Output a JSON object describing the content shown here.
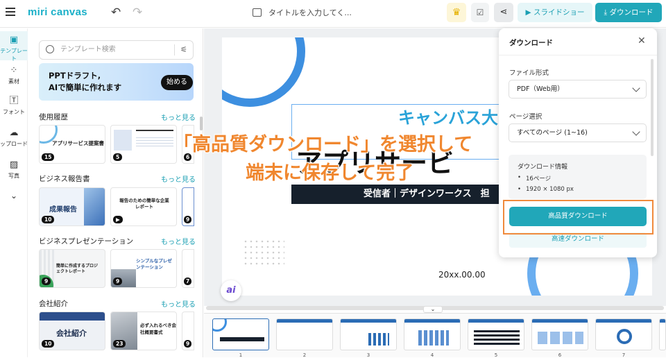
{
  "app": {
    "logo": "miri canvas"
  },
  "header": {
    "doc_title": "タイトルを入力してく...",
    "slideshow_label": "スライドショー",
    "download_label": "ダウンロード"
  },
  "rail": [
    {
      "label": "テンプレート",
      "icon": "template-icon"
    },
    {
      "label": "素材",
      "icon": "elements-icon"
    },
    {
      "label": "フォント",
      "icon": "text-icon"
    },
    {
      "label": "ップロード",
      "icon": "upload-icon"
    },
    {
      "label": "写真",
      "icon": "photo-icon"
    }
  ],
  "panel": {
    "search_placeholder": "テンプレート検索",
    "promo_line1": "PPTドラフト,",
    "promo_line2": "AIで簡単に作れます",
    "promo_button": "始める",
    "more_label": "もっと見る",
    "sections": [
      {
        "title": "使用履歴",
        "thumbs": [
          {
            "num": "15",
            "caption": "アプリサービス提案書"
          },
          {
            "num": "5",
            "caption": ""
          }
        ],
        "extra_num": "6"
      },
      {
        "title": "ビジネス報告書",
        "thumbs": [
          {
            "num": "10",
            "caption": "成果報告"
          },
          {
            "num": "",
            "caption": "報告のための簡単な企業レポート"
          }
        ],
        "extra_num": "9"
      },
      {
        "title": "ビジネスプレゼンテーション",
        "thumbs": [
          {
            "num": "9",
            "caption": "簡単に作成するプロジェクトレポート"
          },
          {
            "num": "9",
            "caption": "シンプルなプレゼンテーション"
          }
        ],
        "extra_num": "7"
      },
      {
        "title": "会社紹介",
        "thumbs": [
          {
            "num": "10",
            "caption": "会社紹介"
          },
          {
            "num": "23",
            "caption": "必ず入れるべき会社概要書式"
          }
        ],
        "extra_num": "9"
      }
    ]
  },
  "slide": {
    "headline": "キャンバス大",
    "title_big": "アプリサービ",
    "subtitle": "受信者｜デザインワークス　担",
    "date": "20xx.00.00"
  },
  "filmstrip": [
    "1",
    "2",
    "3",
    "4",
    "5",
    "6",
    "7"
  ],
  "dialog": {
    "title": "ダウンロード",
    "format_label": "ファイル形式",
    "format_value": "PDF（Web用）",
    "page_label": "ページ選択",
    "page_value": "すべてのページ (1~16)",
    "info_title": "ダウンロード情報",
    "info_pages": "16ページ",
    "info_size": "1920 × 1080 px",
    "hq_button": "高品質ダウンロード",
    "fast_button": "高速ダウンロード"
  },
  "annotation": {
    "line1": "「高品質ダウンロード」を選択して",
    "line2": "端末に保存して完了"
  },
  "ai_badge": "ai",
  "colors": {
    "accent": "#21a7b9",
    "annotation": "#f0872f",
    "brand_blue": "#2aa3d8"
  }
}
